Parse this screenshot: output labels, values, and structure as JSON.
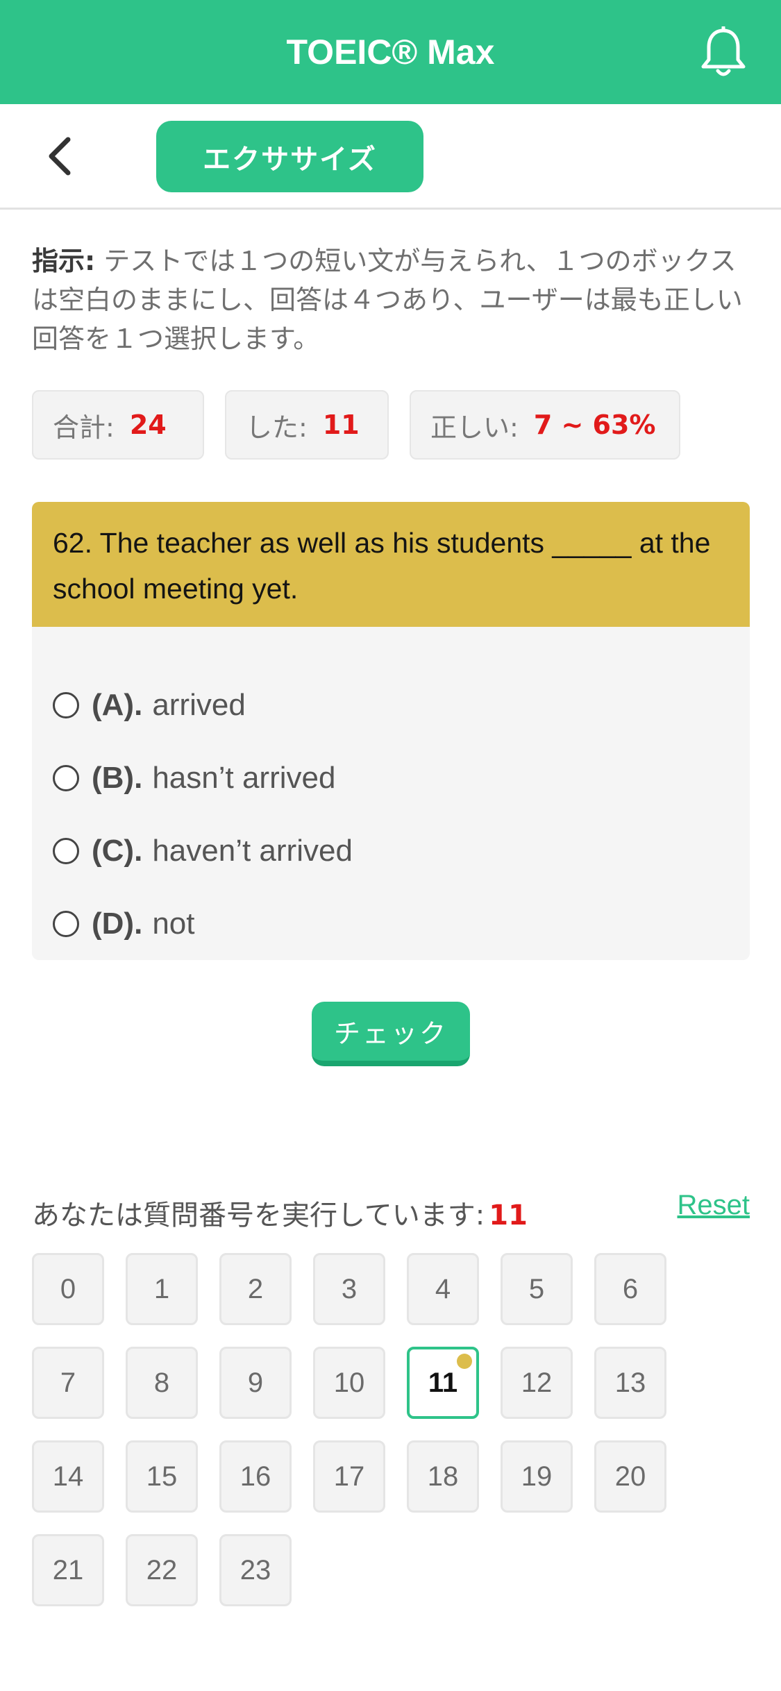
{
  "header": {
    "title": "TOEIC® Max",
    "icon": "bell-icon"
  },
  "subbar": {
    "back_icon": "chevron-left-icon",
    "tab_label": "エクササイズ"
  },
  "instruction": {
    "lead": "指示:",
    "text": " テストでは１つの短い文が与えられ、１つのボックスは空白のままにし、回答は４つあり、ユーザーは最も正しい回答を１つ選択します。"
  },
  "stats": {
    "total_label": "合計:",
    "total_value": "24",
    "done_label": "した:",
    "done_value": "11",
    "correct_label": "正しい:",
    "correct_value": "7 ~ 63%"
  },
  "question": {
    "text": "62. The teacher as well as his students _____ at the school meeting yet.",
    "options": [
      {
        "label": "(A).",
        "text": "arrived"
      },
      {
        "label": "(B).",
        "text": "hasn’t arrived"
      },
      {
        "label": "(C).",
        "text": "haven’t arrived"
      },
      {
        "label": "(D).",
        "text": "not"
      }
    ]
  },
  "check_button": "チェック",
  "progress": {
    "running_label": "あなたは質問番号を実行しています:",
    "current": "11",
    "reset_label": "Reset",
    "numbers": [
      "0",
      "1",
      "2",
      "3",
      "4",
      "5",
      "6",
      "7",
      "8",
      "9",
      "10",
      "11",
      "12",
      "13",
      "14",
      "15",
      "16",
      "17",
      "18",
      "19",
      "20",
      "21",
      "22",
      "23"
    ]
  },
  "colors": {
    "brand": "#2ec389",
    "question_bg": "#dcbd4c",
    "accent_red": "#e11a1a"
  }
}
